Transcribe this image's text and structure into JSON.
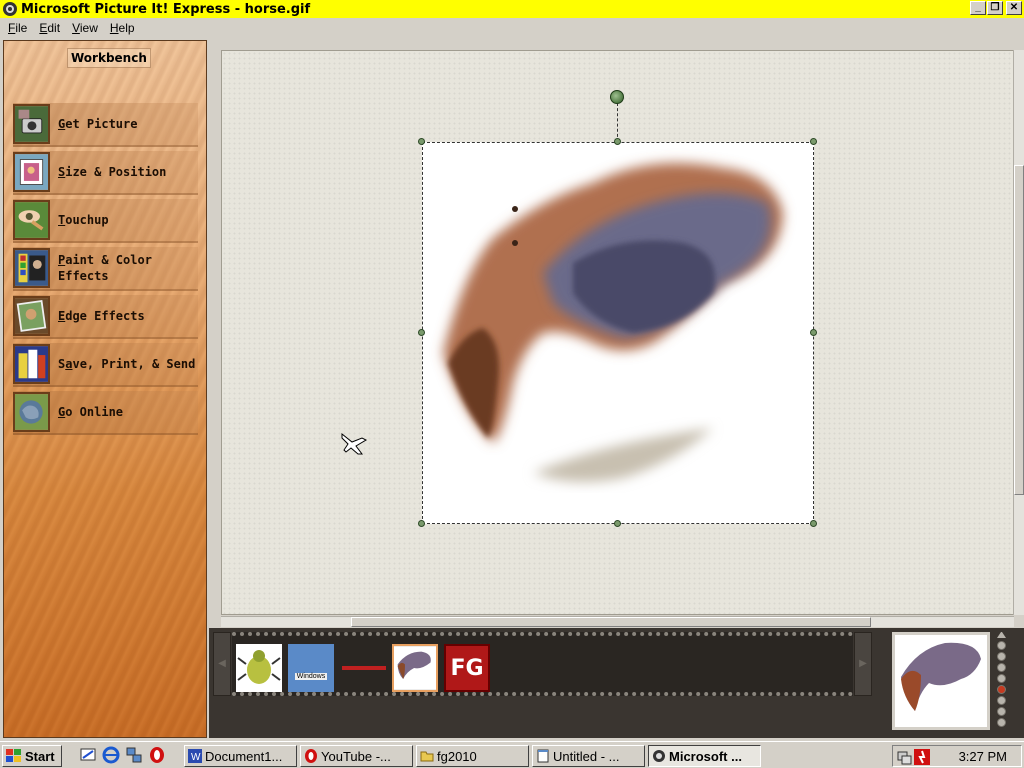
{
  "window": {
    "title": "Microsoft Picture It! Express - horse.gif",
    "controls": {
      "minimize": "_",
      "restore": "❐",
      "close": "✕"
    }
  },
  "menu": [
    {
      "label": "File",
      "accel": "F",
      "rest": "ile"
    },
    {
      "label": "Edit",
      "accel": "E",
      "rest": "dit"
    },
    {
      "label": "View",
      "accel": "V",
      "rest": "iew"
    },
    {
      "label": "Help",
      "accel": "H",
      "rest": "elp"
    }
  ],
  "workbench": {
    "title": "Workbench",
    "items": [
      {
        "accel": "G",
        "rest": "et Picture",
        "line2": "",
        "icon": "camera-icon",
        "color": "#4a6a3a"
      },
      {
        "accel": "S",
        "rest": "ize & Position",
        "line2": "",
        "icon": "resize-icon",
        "color": "#7aa8c0"
      },
      {
        "accel": "T",
        "rest": "ouchup",
        "line2": "",
        "icon": "eye-icon",
        "color": "#5a8a3a"
      },
      {
        "accel": "P",
        "rest": "aint & Color",
        "line2": "Effects",
        "icon": "paint-icon",
        "color": "#3a5a8a"
      },
      {
        "accel": "E",
        "rest": "dge Effects",
        "line2": "",
        "icon": "edge-icon",
        "color": "#6a4a2a"
      },
      {
        "accel": "a",
        "pre": "S",
        "rest": "ve, Print, & Send",
        "line2": "",
        "icon": "save-print-icon",
        "color": "#c8a040"
      },
      {
        "accel": "G",
        "rest": "o Online",
        "line2": "",
        "icon": "globe-icon",
        "color": "#5a7a9a"
      }
    ]
  },
  "filmstrip": {
    "thumbnails": [
      "bug-thumbnail",
      "windows-thumbnail",
      "arrow-thumbnail",
      "horse-thumbnail",
      "fg-thumbnail"
    ],
    "windows_thumb_text": "Windows",
    "fg_text": "FG",
    "page_dots": 9,
    "active_dot": 5
  },
  "taskbar": {
    "start": "Start",
    "tasks": [
      {
        "label": "Document1...",
        "icon": "word-icon"
      },
      {
        "label": "YouTube -...",
        "icon": "opera-icon"
      },
      {
        "label": "fg2010",
        "icon": "folder-icon"
      },
      {
        "label": "Untitled - ...",
        "icon": "notepad-icon"
      },
      {
        "label": "Microsoft ...",
        "icon": "picture-it-icon"
      }
    ],
    "clock": "3:27 PM"
  }
}
